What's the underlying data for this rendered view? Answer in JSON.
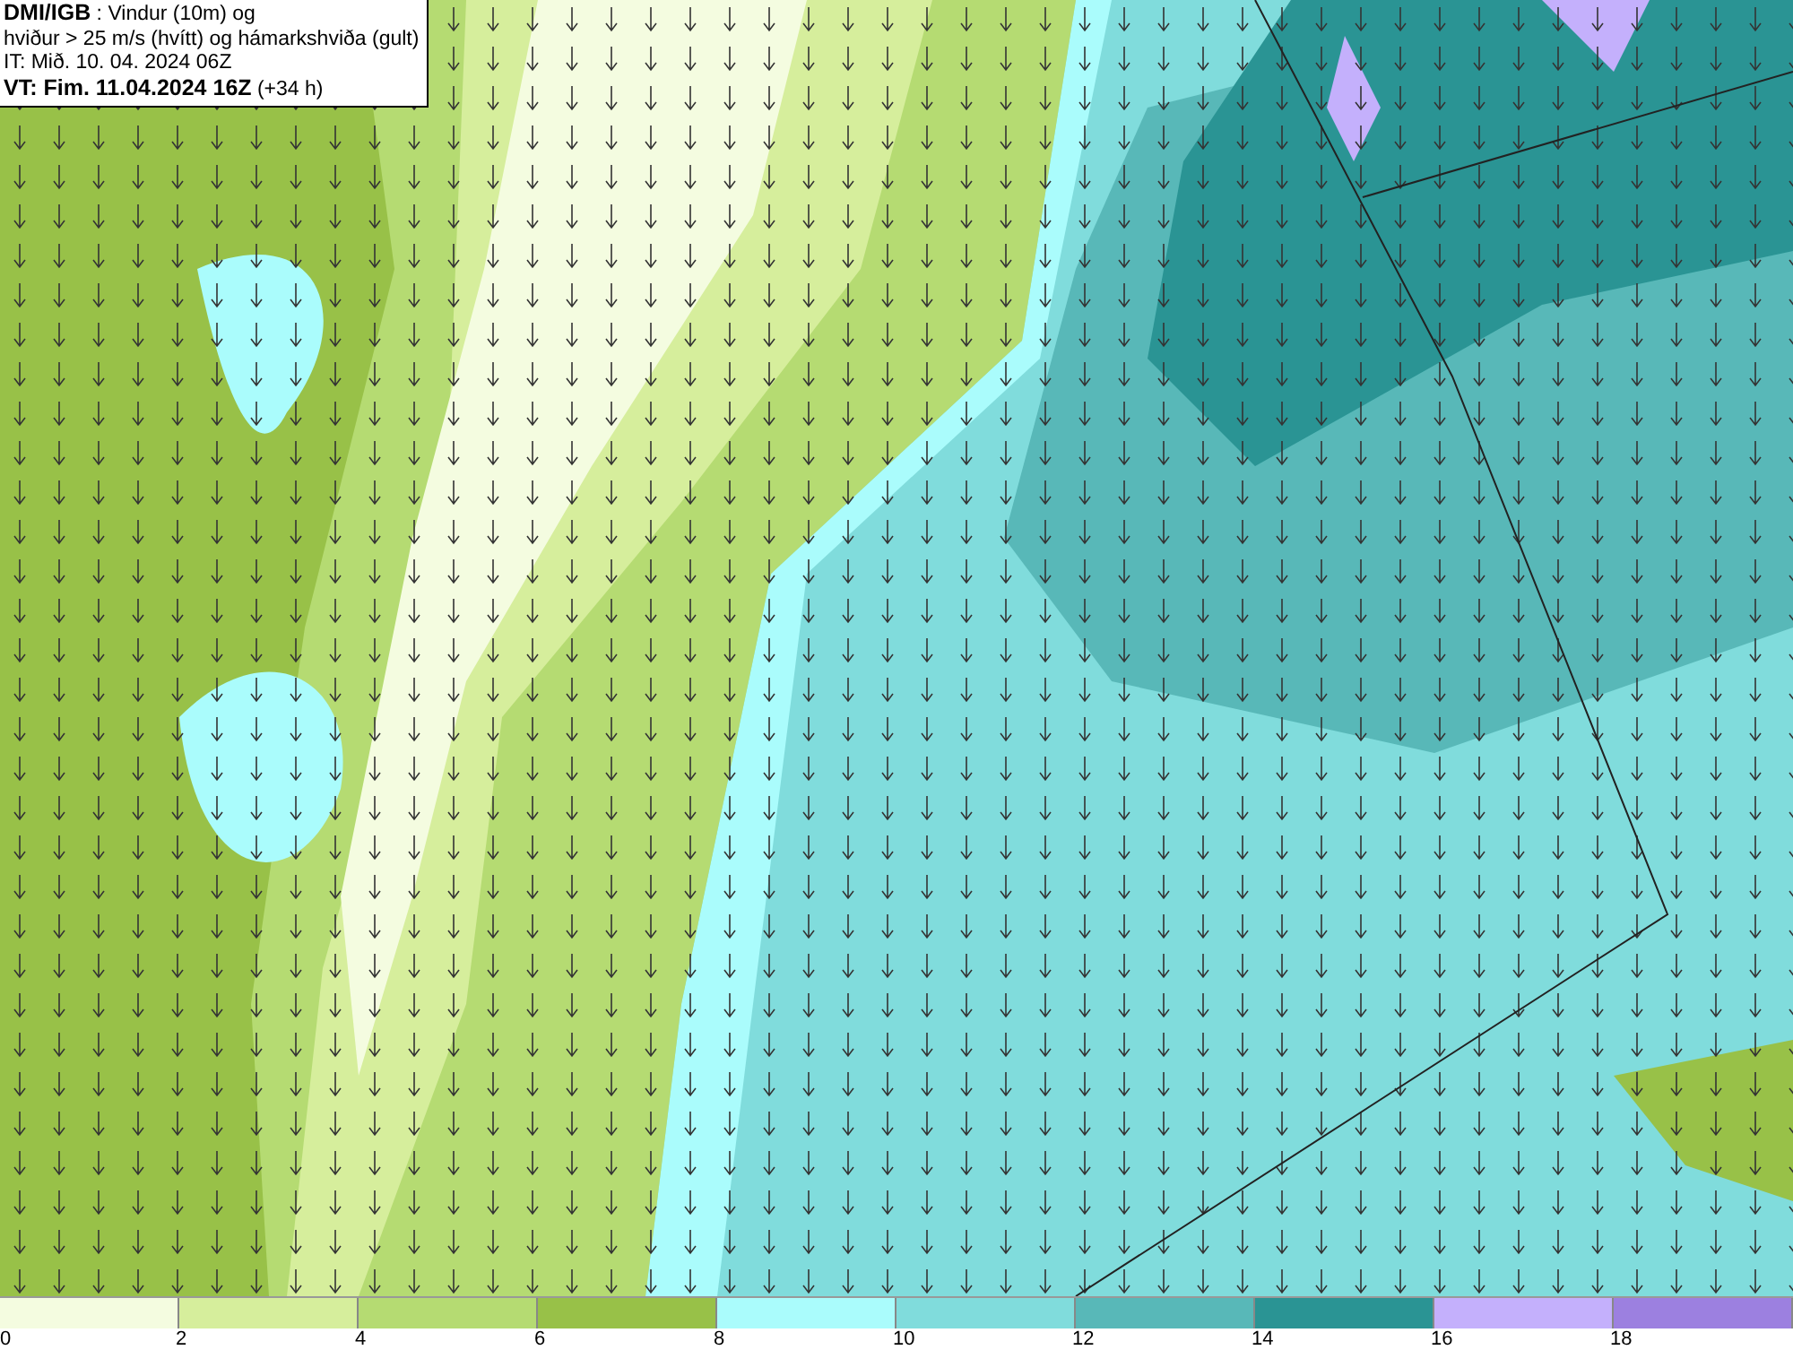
{
  "header": {
    "lines": [
      "**DMI/IGB** : Vindur (10m) og",
      "hviður > 25 m/s (hvítt) og hámarkshviða (gult)",
      "IT: Mið. 10. 04. 2024 06Z",
      "**VT: Fim. 11.04.2024 16Z** (+34 h)"
    ]
  },
  "legend": {
    "segments": [
      {
        "color": "#f4fce0"
      },
      {
        "color": "#d6ee9c"
      },
      {
        "color": "#b5db72"
      },
      {
        "color": "#98c148"
      },
      {
        "color": "#aafcfc"
      },
      {
        "color": "#80dcdc"
      },
      {
        "color": "#58b8b8"
      },
      {
        "color": "#2a9494"
      },
      {
        "color": "#c4b0fc"
      },
      {
        "color": "#9c80e0"
      }
    ],
    "labels": [
      "0",
      "2",
      "4",
      "6",
      "8",
      "10",
      "12",
      "14",
      "16",
      "18"
    ]
  }
}
